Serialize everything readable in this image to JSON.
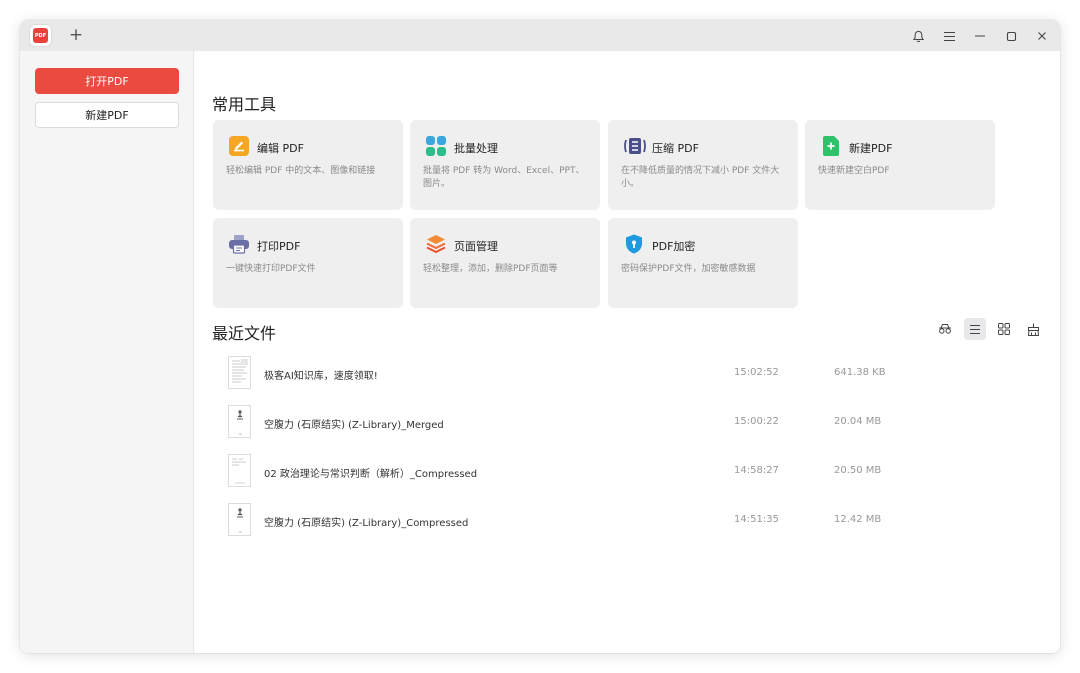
{
  "titlebar": {
    "app_logo_text": "PDF",
    "new_tab_symbol": "+",
    "controls": [
      "bell-icon",
      "menu-icon",
      "minimize-icon",
      "maximize-icon",
      "close-icon"
    ]
  },
  "sidebar": {
    "open_label": "打开PDF",
    "new_label": "新建PDF",
    "accent": "#ea4a3f"
  },
  "tools": {
    "title": "常用工具",
    "items": [
      {
        "name": "编辑 PDF",
        "desc": "轻松编辑 PDF 中的文本、图像和链接",
        "icon": "edit-pdf-icon",
        "color": "#f5a623"
      },
      {
        "name": "批量处理",
        "desc": "批量将 PDF 转为 Word、Excel、PPT、图片。",
        "icon": "batch-process-icon",
        "color": "#3aa7e0"
      },
      {
        "name": "压缩 PDF",
        "desc": "在不降低质量的情况下减小 PDF 文件大小。",
        "icon": "compress-pdf-icon",
        "color": "#4a4f8a"
      },
      {
        "name": "新建PDF",
        "desc": "快速新建空白PDF",
        "icon": "new-pdf-icon",
        "color": "#2ec26a"
      },
      {
        "name": "打印PDF",
        "desc": "一键快速打印PDF文件",
        "icon": "print-pdf-icon",
        "color": "#6b6fa8"
      },
      {
        "name": "页面管理",
        "desc": "轻松整理，添加，删除PDF页面等",
        "icon": "page-manage-icon",
        "color": "#f06b35"
      },
      {
        "name": "PDF加密",
        "desc": "密码保护PDF文件，加密敏感数据",
        "icon": "pdf-encrypt-icon",
        "color": "#1e9be0"
      }
    ]
  },
  "recent": {
    "title": "最近文件",
    "view_icons": [
      "glasses-icon",
      "list-view-icon",
      "grid-view-icon",
      "clean-icon"
    ],
    "files": [
      {
        "name": "极客AI知识库，速度领取!",
        "time": "15:02:52",
        "size": "641.38 KB"
      },
      {
        "name": "空腹力 (石原结实) (Z-Library)_Merged",
        "time": "15:00:22",
        "size": "20.04 MB"
      },
      {
        "name": "02 政治理论与常识判断（解析）_Compressed",
        "time": "14:58:27",
        "size": "20.50 MB"
      },
      {
        "name": "空腹力 (石原结实) (Z-Library)_Compressed",
        "time": "14:51:35",
        "size": "12.42 MB"
      }
    ]
  }
}
